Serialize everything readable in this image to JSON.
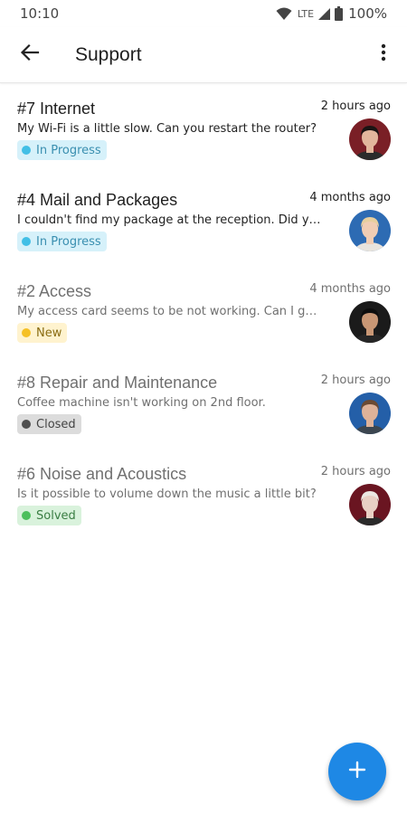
{
  "status_bar": {
    "time": "10:10",
    "network": "LTE",
    "battery": "100%"
  },
  "app_bar": {
    "title": "Support"
  },
  "tickets": [
    {
      "title": "#7 Internet",
      "time": "2 hours ago",
      "message": "My Wi-Fi is a little slow. Can you restart the router?",
      "status": "In Progress",
      "status_bg": "#d6f1fa",
      "status_dot": "#42bfe6",
      "status_text": "#3a8fb0",
      "read": false,
      "avatar": {
        "bg": "#7a1f26",
        "skin": "#e2b79c",
        "hair": "#1a1413",
        "shirt": "#2b2b2b"
      }
    },
    {
      "title": "#4 Mail and Packages",
      "time": "4 months ago",
      "message": "I couldn't find my package at the reception. Did you ...",
      "status": "In Progress",
      "status_bg": "#d6f1fa",
      "status_dot": "#42bfe6",
      "status_text": "#3a8fb0",
      "read": false,
      "avatar": {
        "bg": "#2d6bb3",
        "skin": "#f0cdb4",
        "hair": "#e7cf9e",
        "shirt": "#e9e4dd"
      }
    },
    {
      "title": "#2 Access",
      "time": "4 months ago",
      "message": "My access card seems to be not working. Can I get a...",
      "status": "New",
      "status_bg": "#fff3cf",
      "status_dot": "#f5c026",
      "status_text": "#8a6d12",
      "read": true,
      "avatar": {
        "bg": "#1b1b1b",
        "skin": "#c99775",
        "hair": "#0e0e0e",
        "shirt": "#262626"
      }
    },
    {
      "title": "#8 Repair and Maintenance",
      "time": "2 hours ago",
      "message": "Coffee machine isn't working on 2nd floor.",
      "status": "Closed",
      "status_bg": "#dcdcdc",
      "status_dot": "#4f4f4f",
      "status_text": "#444444",
      "read": true,
      "avatar": {
        "bg": "#245fa8",
        "skin": "#deb299",
        "hair": "#6b4a33",
        "shirt": "#3c4650"
      }
    },
    {
      "title": "#6 Noise and Acoustics",
      "time": "2 hours ago",
      "message": "Is it possible to volume down the music a little bit?",
      "status": "Solved",
      "status_bg": "#d9f2dc",
      "status_dot": "#4cbf5c",
      "status_text": "#3a7d43",
      "read": true,
      "avatar": {
        "bg": "#6a1521",
        "skin": "#e9d0c4",
        "hair": "#ece8e2",
        "shirt": "#2a2a2a"
      }
    }
  ],
  "icons": {
    "back": "arrow-left-icon",
    "menu": "more-vert-icon",
    "fab": "plus-icon"
  },
  "colors": {
    "accent": "#1e88e5"
  }
}
